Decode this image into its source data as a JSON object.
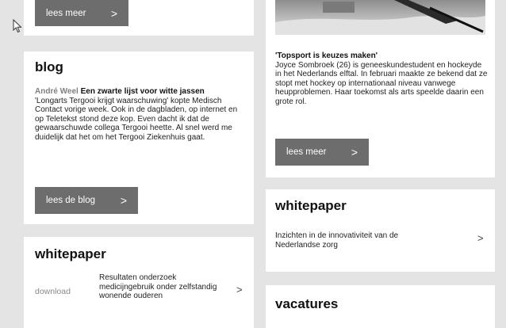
{
  "top_left_card": {
    "button_label": "lees meer",
    "button_chevron": ">"
  },
  "blog": {
    "heading": "blog",
    "author": "André Weel",
    "title": "Een zwarte lijst voor witte jassen",
    "body": "'Longarts Tergooi krijgt waarschuwing' kopte Medisch Contact vorige week. Ook in de dagbladen, op internet en op Teletekst stond deze kop. Even dacht ik dat de gewaarschuwde collega Tergooi heette. Al snel werd me duidelijk dat het om het Tergooi Ziekenhuis gaat.",
    "button_label": "lees de blog",
    "button_chevron": ">"
  },
  "whitepaper_left": {
    "heading": "whitepaper",
    "download_label": "download",
    "item_text": "Resultaten onderzoek medicijngebruik onder zelfstandig wonende ouderen",
    "chevron": ">"
  },
  "topsport": {
    "title": "'Topsport is keuzes maken'",
    "body": "Joyce Sombroek (26) is geneeskundestudent en hockeyde in het Nederlands elftal. In februari maakte ze bekend dat ze stopt met hockey op internationaal niveau vanwege heupproblemen. Haar toekomst als arts speelde daarin een grote rol.",
    "button_label": "lees meer",
    "button_chevron": ">"
  },
  "whitepaper_right": {
    "heading": "whitepaper",
    "item_text": "Inzichten in de innovativiteit van de Nederlandse zorg",
    "chevron": ">"
  },
  "vacatures": {
    "heading": "vacatures"
  },
  "icons": {
    "cursor": "mouse-pointer-icon",
    "chevron": "chevron-right-icon",
    "photo": "hockey-photo"
  },
  "colors": {
    "page_bg": "#e4e4e4",
    "card_bg": "#ffffff",
    "button_bg": "#6d6d6d",
    "button_text": "#ffffff",
    "muted_text": "#808080"
  }
}
